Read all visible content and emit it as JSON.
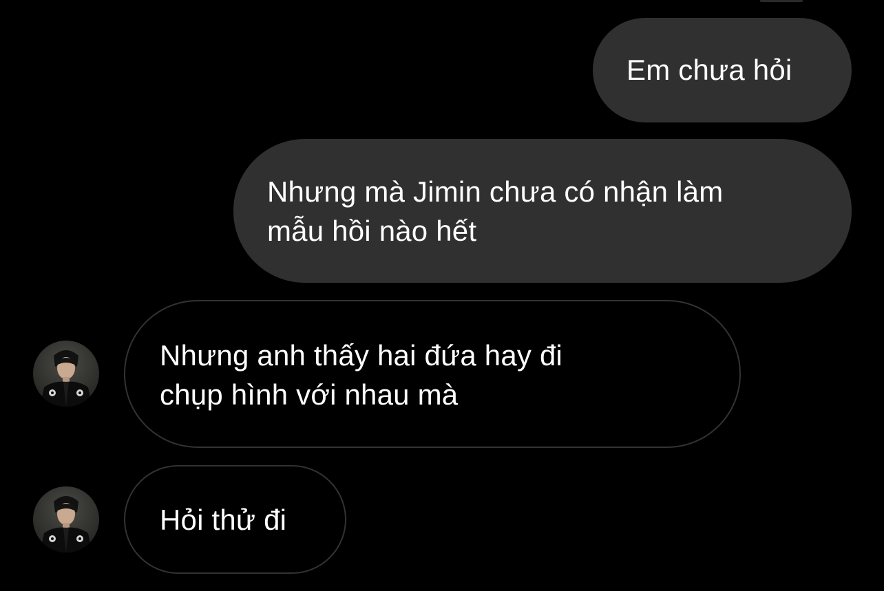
{
  "conversation": {
    "messages": [
      {
        "direction": "sent",
        "text": "Em chưa hỏi"
      },
      {
        "direction": "sent",
        "text": "Nhưng mà Jimin chưa có nhận làm\nmẫu hồi nào hết"
      },
      {
        "direction": "received",
        "text": "Nhưng anh thấy hai đứa hay đi\nchụp hình với nhau mà"
      },
      {
        "direction": "received",
        "text": "Hỏi thử đi"
      }
    ]
  },
  "colors": {
    "background": "#000000",
    "sent_bubble": "#303030",
    "received_bubble_border": "#333333",
    "text": "#ffffff"
  },
  "icons": {
    "avatar": "contact-avatar-photo"
  }
}
